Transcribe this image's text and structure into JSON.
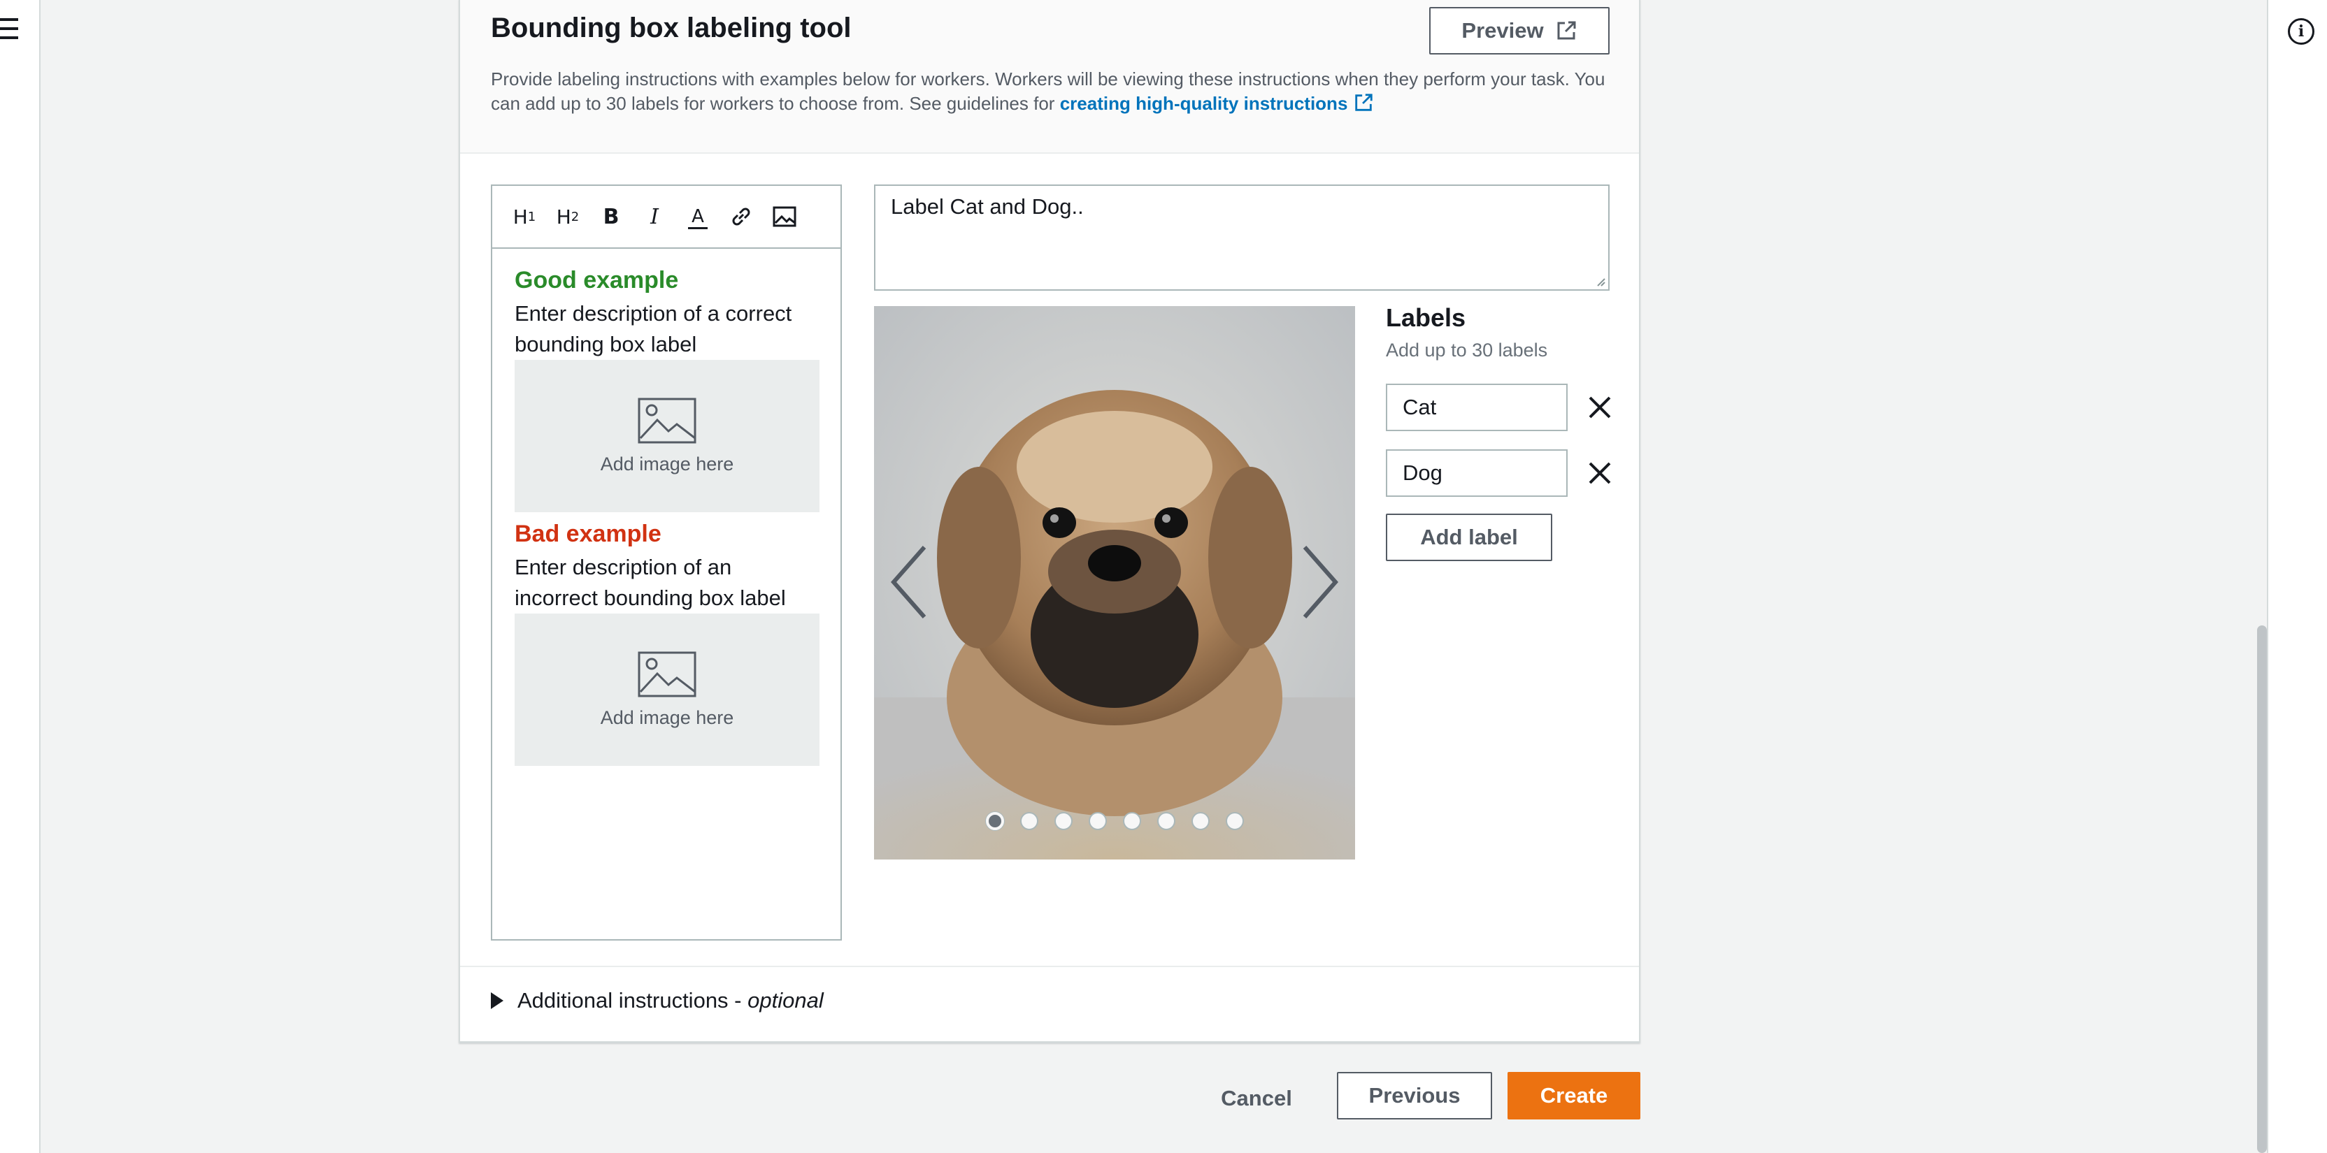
{
  "colors": {
    "accent_orange": "#ec7211",
    "link_blue": "#0073bb",
    "good_green": "#2a8b2a",
    "bad_red": "#d13212"
  },
  "header": {
    "title": "Bounding box labeling tool",
    "preview_label": "Preview",
    "description_text": "Provide labeling instructions with examples below for workers. Workers will be viewing these instructions when they perform your task. You can add up to 30 labels for workers to choose from. See guidelines for",
    "description_link": "creating high-quality instructions"
  },
  "editor": {
    "toolbar_icons": [
      "heading-1-icon",
      "heading-2-icon",
      "bold-icon",
      "italic-icon",
      "text-color-icon",
      "link-icon",
      "image-icon"
    ],
    "toolbar": {
      "h1": "H",
      "h1_sub": "1",
      "h2": "H",
      "h2_sub": "2",
      "bold": "B",
      "italic": "I",
      "color": "A"
    },
    "good_example": {
      "heading": "Good example",
      "description": "Enter description of a correct bounding box label",
      "image_placeholder": "Add image here"
    },
    "bad_example": {
      "heading": "Bad example",
      "description": "Enter description of an incorrect bounding box label",
      "image_placeholder": "Add image here"
    }
  },
  "instructions": {
    "value": "Label Cat and Dog.."
  },
  "carousel": {
    "slide_count": 8,
    "active_index": 0
  },
  "labels": {
    "title": "Labels",
    "hint": "Add up to 30 labels",
    "items": [
      "Cat",
      "Dog"
    ],
    "add_label": "Add label"
  },
  "additional": {
    "label": "Additional instructions -",
    "optional": "optional"
  },
  "footer": {
    "cancel": "Cancel",
    "previous": "Previous",
    "create": "Create"
  }
}
